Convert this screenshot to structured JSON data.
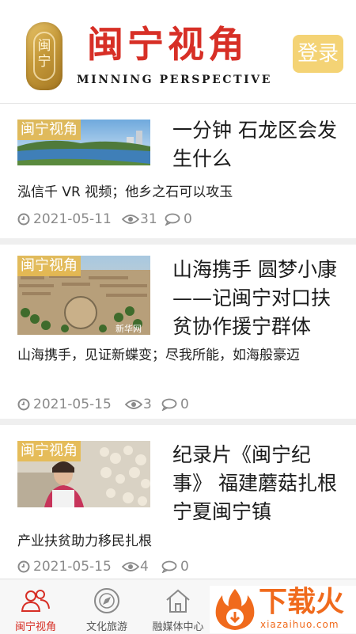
{
  "header": {
    "seal_text": "闽宁",
    "title": "闽宁视角",
    "subtitle": "MINNING  PERSPECTIVE",
    "login_label": "登录"
  },
  "articles": [
    {
      "tag": "闽宁视角",
      "title": "一分钟 石龙区会发生什么",
      "summary": "泓信千 VR 视频；他乡之石可以攻玉",
      "date": "2021-05-11",
      "views": "31",
      "comments": "0"
    },
    {
      "tag": "闽宁视角",
      "title": "山海携手 圆梦小康——记闽宁对口扶贫协作援宁群体",
      "summary": "山海携手，见证新蝶变；尽我所能，如海般豪迈",
      "watermark": "新华网",
      "date": "2021-05-15",
      "views": "3",
      "comments": "0"
    },
    {
      "tag": "闽宁视角",
      "title": "纪录片《闽宁纪事》 福建蘑菇扎根宁夏闽宁镇",
      "summary": "产业扶贫助力移民扎根",
      "date": "2021-05-15",
      "views": "4",
      "comments": "0"
    }
  ],
  "tabbar": {
    "items": [
      {
        "label": "闽宁视角",
        "icon": "people-icon",
        "active": true
      },
      {
        "label": "文化旅游",
        "icon": "compass-icon",
        "active": false
      },
      {
        "label": "融媒体中心",
        "icon": "home-icon",
        "active": false
      }
    ]
  },
  "promo": {
    "cn": "下载火",
    "en": "xiazaihuo.com"
  },
  "colors": {
    "brand_red": "#d72f26",
    "login_yellow": "#f4d375",
    "tag_gold": "#e6ba50",
    "meta_gray": "#8a8a8a",
    "promo_orange": "#f06a1c"
  }
}
